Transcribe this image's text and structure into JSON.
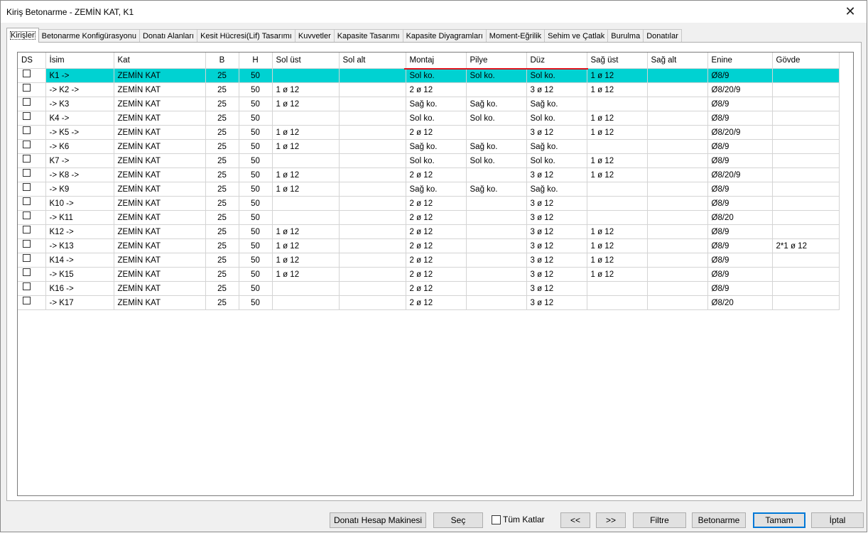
{
  "window": {
    "title": "Kiriş Betonarme - ZEMİN KAT, K1",
    "close": "✕"
  },
  "tabs": [
    {
      "label": "Kirişler"
    },
    {
      "label": "Betonarme Konfigürasyonu"
    },
    {
      "label": "Donatı Alanları"
    },
    {
      "label": "Kesit Hücresi(Lif) Tasarımı"
    },
    {
      "label": "Kuvvetler"
    },
    {
      "label": "Kapasite Tasarımı"
    },
    {
      "label": "Kapasite Diyagramları"
    },
    {
      "label": "Moment-Eğrilik"
    },
    {
      "label": "Sehim ve Çatlak"
    },
    {
      "label": "Burulma"
    },
    {
      "label": "Donatılar"
    }
  ],
  "table": {
    "headers": [
      "DS",
      "İsim",
      "Kat",
      "B",
      "H",
      "Sol üst",
      "Sol alt",
      "Montaj",
      "Pilye",
      "Düz",
      "Sağ üst",
      "Sağ alt",
      "Enine",
      "Gövde"
    ],
    "rows": [
      [
        "",
        "K1 ->",
        "ZEMİN KAT",
        "25",
        "50",
        "",
        "",
        "Sol ko.",
        "Sol ko.",
        "Sol ko.",
        "1 ø 12",
        "",
        "Ø8/9",
        ""
      ],
      [
        "",
        "-> K2 ->",
        "ZEMİN KAT",
        "25",
        "50",
        "1 ø 12",
        "",
        "2 ø 12",
        "",
        "3 ø 12",
        "1 ø 12",
        "",
        "Ø8/20/9",
        ""
      ],
      [
        "",
        "-> K3",
        "ZEMİN KAT",
        "25",
        "50",
        "1 ø 12",
        "",
        "Sağ ko.",
        "Sağ ko.",
        "Sağ ko.",
        "",
        "",
        "Ø8/9",
        ""
      ],
      [
        "",
        "K4 ->",
        "ZEMİN KAT",
        "25",
        "50",
        "",
        "",
        "Sol ko.",
        "Sol ko.",
        "Sol ko.",
        "1 ø 12",
        "",
        "Ø8/9",
        ""
      ],
      [
        "",
        "-> K5 ->",
        "ZEMİN KAT",
        "25",
        "50",
        "1 ø 12",
        "",
        "2 ø 12",
        "",
        "3 ø 12",
        "1 ø 12",
        "",
        "Ø8/20/9",
        ""
      ],
      [
        "",
        "-> K6",
        "ZEMİN KAT",
        "25",
        "50",
        "1 ø 12",
        "",
        "Sağ ko.",
        "Sağ ko.",
        "Sağ ko.",
        "",
        "",
        "Ø8/9",
        ""
      ],
      [
        "",
        "K7 ->",
        "ZEMİN KAT",
        "25",
        "50",
        "",
        "",
        "Sol ko.",
        "Sol ko.",
        "Sol ko.",
        "1 ø 12",
        "",
        "Ø8/9",
        ""
      ],
      [
        "",
        "-> K8 ->",
        "ZEMİN KAT",
        "25",
        "50",
        "1 ø 12",
        "",
        "2 ø 12",
        "",
        "3 ø 12",
        "1 ø 12",
        "",
        "Ø8/20/9",
        ""
      ],
      [
        "",
        "-> K9",
        "ZEMİN KAT",
        "25",
        "50",
        "1 ø 12",
        "",
        "Sağ ko.",
        "Sağ ko.",
        "Sağ ko.",
        "",
        "",
        "Ø8/9",
        ""
      ],
      [
        "",
        "K10 ->",
        "ZEMİN KAT",
        "25",
        "50",
        "",
        "",
        "2 ø 12",
        "",
        "3 ø 12",
        "",
        "",
        "Ø8/9",
        ""
      ],
      [
        "",
        "-> K11",
        "ZEMİN KAT",
        "25",
        "50",
        "",
        "",
        "2 ø 12",
        "",
        "3 ø 12",
        "",
        "",
        "Ø8/20",
        ""
      ],
      [
        "",
        "K12 ->",
        "ZEMİN KAT",
        "25",
        "50",
        "1 ø 12",
        "",
        "2 ø 12",
        "",
        "3 ø 12",
        "1 ø 12",
        "",
        "Ø8/9",
        ""
      ],
      [
        "",
        "-> K13",
        "ZEMİN KAT",
        "25",
        "50",
        "1 ø 12",
        "",
        "2 ø 12",
        "",
        "3 ø 12",
        "1 ø 12",
        "",
        "Ø8/9",
        "2*1 ø 12"
      ],
      [
        "",
        "K14 ->",
        "ZEMİN KAT",
        "25",
        "50",
        "1 ø 12",
        "",
        "2 ø 12",
        "",
        "3 ø 12",
        "1 ø 12",
        "",
        "Ø8/9",
        ""
      ],
      [
        "",
        "-> K15",
        "ZEMİN KAT",
        "25",
        "50",
        "1 ø 12",
        "",
        "2 ø 12",
        "",
        "3 ø 12",
        "1 ø 12",
        "",
        "Ø8/9",
        ""
      ],
      [
        "",
        "K16 ->",
        "ZEMİN KAT",
        "25",
        "50",
        "",
        "",
        "2 ø 12",
        "",
        "3 ø 12",
        "",
        "",
        "Ø8/9",
        ""
      ],
      [
        "",
        "-> K17",
        "ZEMİN KAT",
        "25",
        "50",
        "",
        "",
        "2 ø 12",
        "",
        "3 ø 12",
        "",
        "",
        "Ø8/20",
        ""
      ]
    ],
    "selected_row_color": "#00d2d2",
    "annotation_color": "#e0101a"
  },
  "buttons": {
    "calc": "Donatı Hesap Makinesi",
    "select": "Seç",
    "all_floors": "Tüm Katlar",
    "prev": "<<",
    "next": ">>",
    "filter": "Filtre",
    "concrete": "Betonarme",
    "ok": "Tamam",
    "cancel": "İptal"
  }
}
